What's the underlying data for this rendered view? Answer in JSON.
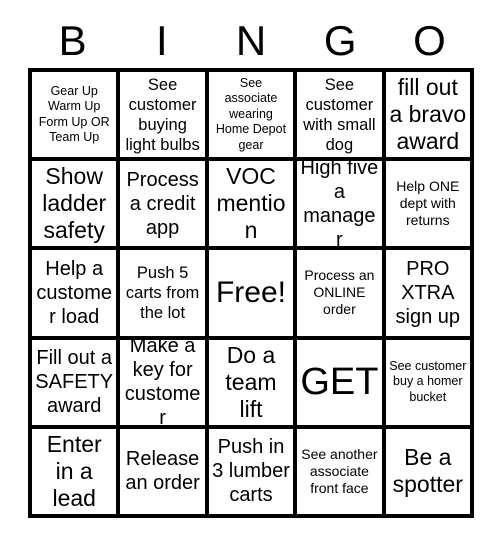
{
  "card": {
    "title": "BINGO",
    "header_letters": [
      "B",
      "I",
      "N",
      "G",
      "O"
    ],
    "rows": 5,
    "columns": 5,
    "colors": {
      "background": "#ffffff",
      "text": "#000000",
      "grid_line": "#000000"
    },
    "free_space": {
      "row": 3,
      "column": 3,
      "label": "Free!"
    },
    "cells": [
      {
        "text": "Gear Up Warm Up Form Up OR Team Up",
        "size": "xs"
      },
      {
        "text": "See customer buying light bulbs",
        "size": "md"
      },
      {
        "text": "See associate wearing Home Depot gear",
        "size": "xs"
      },
      {
        "text": "See customer with small dog",
        "size": "md"
      },
      {
        "text": "fill out a bravo award",
        "size": "xl"
      },
      {
        "text": "Show ladder safety",
        "size": "xl"
      },
      {
        "text": "Process a credit app",
        "size": "lg"
      },
      {
        "text": "VOC mention",
        "size": "xl"
      },
      {
        "text": "High five a manager",
        "size": "lg"
      },
      {
        "text": "Help ONE dept with returns",
        "size": "sm"
      },
      {
        "text": "Help a customer load",
        "size": "lg"
      },
      {
        "text": "Push 5 carts from the lot",
        "size": "md"
      },
      {
        "text": "Free!",
        "size": "xxl"
      },
      {
        "text": "Process an ONLINE order",
        "size": "sm"
      },
      {
        "text": "PRO XTRA sign up",
        "size": "lg"
      },
      {
        "text": "Fill out a SAFETY award",
        "size": "lg"
      },
      {
        "text": "Make a key for customer",
        "size": "lg"
      },
      {
        "text": "Do a team lift",
        "size": "xl"
      },
      {
        "text": "GET",
        "size": "huge"
      },
      {
        "text": "See customer buy a homer bucket",
        "size": "xs"
      },
      {
        "text": "Enter in a lead",
        "size": "xl"
      },
      {
        "text": "Release an order",
        "size": "lg"
      },
      {
        "text": "Push in 3 lumber carts",
        "size": "lg"
      },
      {
        "text": "See another associate front face",
        "size": "sm"
      },
      {
        "text": "Be a spotter",
        "size": "xl"
      }
    ]
  }
}
